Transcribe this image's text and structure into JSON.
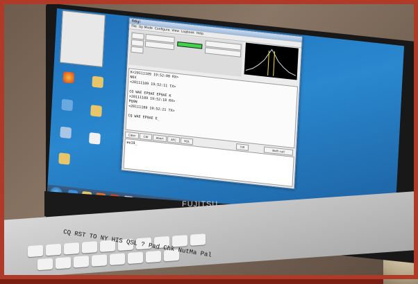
{
  "photo": {
    "laptop_brand": "FUJITSU",
    "handwritten_note": "CQ RST TO NY HIS QSL ? Pad Chk NutMa Pal"
  },
  "screen": {
    "app": {
      "title": "fldigi",
      "menu": [
        "File",
        "Op Mode",
        "Configure",
        "View",
        "Logbook",
        "Help"
      ],
      "rx_lines": [
        "K<20111109 19:52:00 RX>",
        "N6X",
        "<20111109 19:52:11 TX>",
        "",
        "CQ WAE EP9AE EP9AE K",
        "<20111109 19:52:18 RX>",
        "PQ9N",
        "<20111109 19:52:21 TX>",
        "",
        "CQ WAE EP9AE E_"
      ],
      "buttons": [
        "Clear",
        "CW",
        "Abort",
        "AFC",
        "SQL",
        "T/R",
        "Both call"
      ],
      "tx_text": "ee19_"
    }
  },
  "colors": {
    "frame": "#b03a28",
    "desktop": "#1f79c2",
    "level": "#3fd34a"
  }
}
